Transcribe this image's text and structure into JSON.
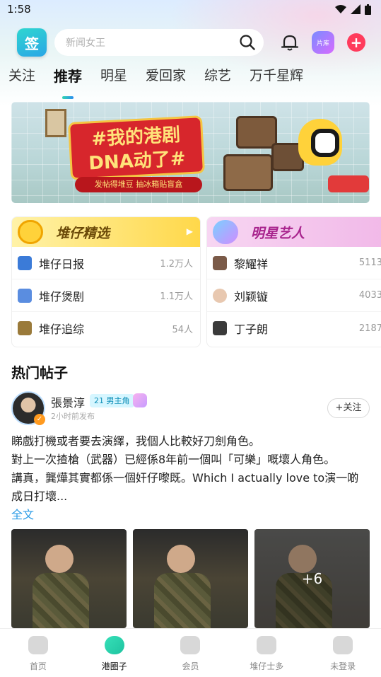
{
  "status_bar": {
    "time": "1:58"
  },
  "header": {
    "sign_label": "签",
    "search_placeholder": "新闻女王",
    "library_label": "片库"
  },
  "tabs": [
    {
      "label": "关注",
      "active": false
    },
    {
      "label": "推荐",
      "active": true
    },
    {
      "label": "明星",
      "active": false
    },
    {
      "label": "爱回家",
      "active": false
    },
    {
      "label": "综艺",
      "active": false
    },
    {
      "label": "万千星辉",
      "active": false
    }
  ],
  "banner": {
    "title": "#我的港剧DNA动了#",
    "subtitle": "发帖得堆豆 抽冰箱贴盲盒"
  },
  "cards": {
    "left": {
      "title": "堆仔精选",
      "rows": [
        {
          "name": "堆仔日报",
          "count": "1.2万人"
        },
        {
          "name": "堆仔煲剧",
          "count": "1.1万人"
        },
        {
          "name": "堆仔追综",
          "count": "54人"
        }
      ]
    },
    "right": {
      "title": "明星艺人",
      "rows": [
        {
          "name": "黎耀祥",
          "count": "5113"
        },
        {
          "name": "刘颖镟",
          "count": "4033"
        },
        {
          "name": "丁子朗",
          "count": "2187"
        }
      ]
    }
  },
  "hot_posts": {
    "section_title": "热门帖子",
    "post": {
      "author": "張景淳",
      "role_badge": "21 男主角",
      "time": "2小时前发布",
      "follow_label": "+关注",
      "lines": [
        "睇戲打機或者要去演繹，我個人比較好刀劍角色。",
        "對上一次揸槍（武器）已經係8年前一個叫「可樂」嘅壞人角色。",
        "講真，龔燁其實都係一個奸仔嚟既。Which I actually love to演一啲",
        "成日打壞..."
      ],
      "read_more": "全文",
      "more_photos": "+6"
    }
  },
  "bottom_nav": [
    {
      "label": "首页",
      "active": false
    },
    {
      "label": "港圈子",
      "active": true
    },
    {
      "label": "会员",
      "active": false
    },
    {
      "label": "堆仔士多",
      "active": false
    },
    {
      "label": "未登录",
      "active": false
    }
  ]
}
